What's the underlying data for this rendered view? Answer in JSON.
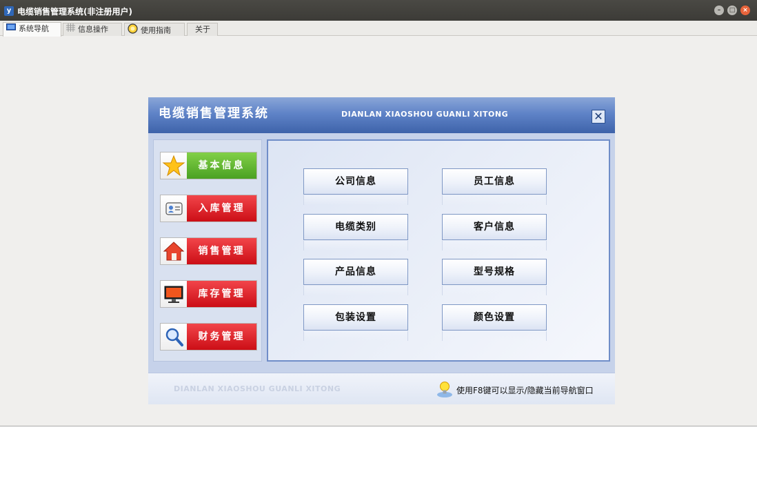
{
  "window": {
    "title": "电缆销售管理系统(非注册用户)",
    "app_icon_glyph": "y"
  },
  "tabs": [
    {
      "label": "系统导航",
      "icon": "monitor-icon",
      "active": true
    },
    {
      "label": "信息操作",
      "icon": "grid-icon",
      "active": false
    },
    {
      "label": "使用指南",
      "icon": "help-circle-icon",
      "active": false
    },
    {
      "label": "关于",
      "icon": "",
      "active": false
    }
  ],
  "nav": {
    "title": "电缆销售管理系统",
    "subtitle": "DIANLAN XIAOSHOU GUANLI XITONG",
    "close_glyph": "✕",
    "side_buttons": [
      {
        "label": "基本信息",
        "icon": "star-icon",
        "color": "green"
      },
      {
        "label": "入库管理",
        "icon": "id-card-icon",
        "color": "red"
      },
      {
        "label": "销售管理",
        "icon": "house-icon",
        "color": "red"
      },
      {
        "label": "库存管理",
        "icon": "monitor-icon",
        "color": "red"
      },
      {
        "label": "财务管理",
        "icon": "magnifier-icon",
        "color": "red"
      }
    ],
    "operations": [
      {
        "label": "公司信息"
      },
      {
        "label": "员工信息"
      },
      {
        "label": "电缆类别"
      },
      {
        "label": "客户信息"
      },
      {
        "label": "产品信息"
      },
      {
        "label": "型号规格"
      },
      {
        "label": "包装设置"
      },
      {
        "label": "颜色设置"
      }
    ],
    "footer": {
      "brand": "DIANLAN XIAOSHOU GUANLI XITONG",
      "tip": "使用F8键可以显示/隐藏当前导航窗口",
      "tip_icon": "lightbulb-icon"
    }
  },
  "colors": {
    "green_button": "#4aa122",
    "red_button": "#cc0e16",
    "header_blue": "#3e63aa",
    "panel_border": "#6f8dc8"
  }
}
